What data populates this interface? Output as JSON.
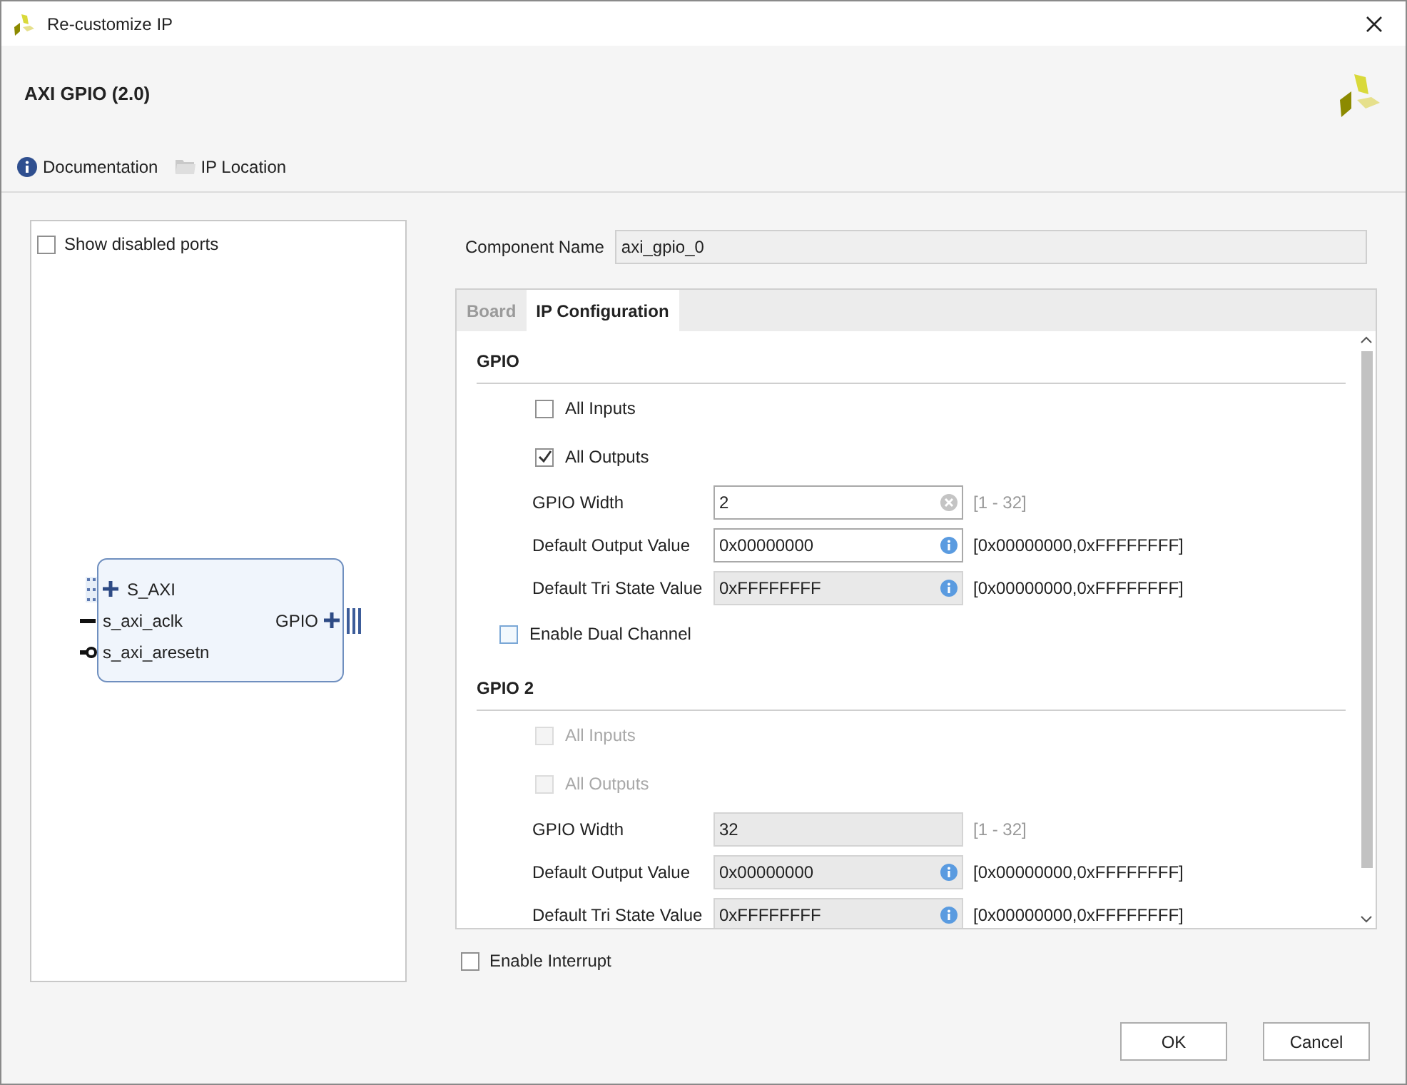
{
  "window": {
    "title": "Re-customize IP"
  },
  "header": {
    "title": "AXI GPIO (2.0)",
    "links": [
      {
        "kind": "info",
        "label": "Documentation"
      },
      {
        "kind": "folder",
        "label": "IP Location"
      }
    ]
  },
  "symbol_panel": {
    "show_disabled_ports": {
      "label": "Show disabled ports",
      "checked": false
    },
    "block": {
      "left_ports": [
        {
          "kind": "bus",
          "label": "S_AXI"
        },
        {
          "kind": "clock",
          "label": "s_axi_aclk"
        },
        {
          "kind": "reset",
          "label": "s_axi_aresetn"
        }
      ],
      "right_ports": [
        {
          "kind": "bus",
          "label": "GPIO"
        }
      ]
    }
  },
  "component_name": {
    "label": "Component Name",
    "value": "axi_gpio_0"
  },
  "tabs": [
    {
      "label": "Board",
      "selected": false
    },
    {
      "label": "IP Configuration",
      "selected": true
    }
  ],
  "rows": [
    {
      "kind": "heading",
      "text": "GPIO"
    },
    {
      "kind": "checkbox",
      "label": "All Inputs",
      "checked": false,
      "disabled": false
    },
    {
      "kind": "checkbox",
      "label": "All Outputs",
      "checked": true,
      "disabled": false
    },
    {
      "kind": "field",
      "label": "GPIO Width",
      "value": "2",
      "disabled": false,
      "clear_button": true,
      "info_button": false,
      "range": "[1 - 32]"
    },
    {
      "kind": "field",
      "label": "Default Output Value",
      "value": "0x00000000",
      "disabled": false,
      "clear_button": false,
      "info_button": true,
      "range": "[0x00000000,0xFFFFFFFF]"
    },
    {
      "kind": "field",
      "label": "Default Tri State Value",
      "value": "0xFFFFFFFF",
      "disabled": true,
      "clear_button": false,
      "info_button": true,
      "range": "[0x00000000,0xFFFFFFFF]"
    },
    {
      "kind": "option",
      "label": "Enable Dual Channel",
      "checked": false,
      "disabled": false
    },
    {
      "kind": "heading",
      "text": "GPIO 2"
    },
    {
      "kind": "checkbox",
      "label": "All Inputs",
      "checked": false,
      "disabled": true
    },
    {
      "kind": "checkbox",
      "label": "All Outputs",
      "checked": false,
      "disabled": true
    },
    {
      "kind": "field",
      "label": "GPIO Width",
      "value": "32",
      "disabled": true,
      "clear_button": false,
      "info_button": false,
      "range": "[1 - 32]"
    },
    {
      "kind": "field",
      "label": "Default Output Value",
      "value": "0x00000000",
      "disabled": true,
      "clear_button": false,
      "info_button": true,
      "range": "[0x00000000,0xFFFFFFFF]"
    },
    {
      "kind": "field",
      "label": "Default Tri State Value",
      "value": "0xFFFFFFFF",
      "disabled": true,
      "clear_button": false,
      "info_button": true,
      "range": "[0x00000000,0xFFFFFFFF]"
    }
  ],
  "enable_interrupt": {
    "label": "Enable Interrupt",
    "checked": false
  },
  "buttons": [
    {
      "label": "OK"
    },
    {
      "label": "Cancel"
    }
  ]
}
